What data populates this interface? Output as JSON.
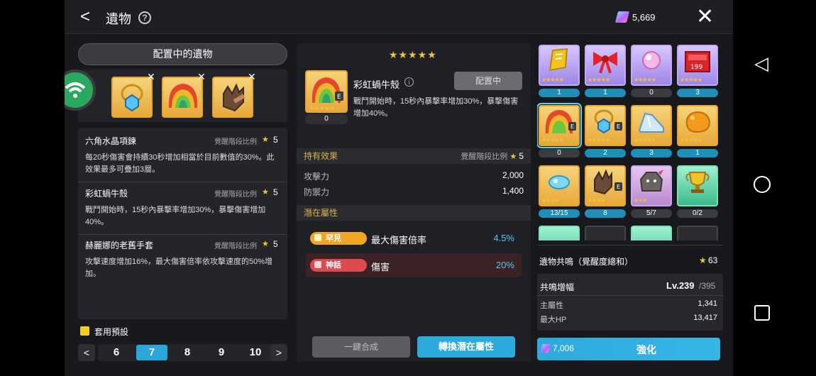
{
  "header": {
    "title": "遺物",
    "help": "?",
    "currency_value": "5,669",
    "back": "<",
    "close": "✕"
  },
  "left": {
    "equipped_header": "配置中的遺物",
    "descriptions": [
      {
        "name": "六角水晶項鍊",
        "rate_label": "覺醒階段比例",
        "star": "★",
        "level": "5",
        "desc": "每20秒傷害會持續30秒增加相當於目前數值的30%。此效果最多可疊加3層。"
      },
      {
        "name": "彩虹蝸牛殼",
        "rate_label": "覺醒階段比例",
        "star": "★",
        "level": "5",
        "desc": "戰鬥開始時，15秒內暴擊率增加30%，暴擊傷害增加40%。"
      },
      {
        "name": "赫麗娜的老舊手套",
        "rate_label": "覺醒階段比例",
        "star": "★",
        "level": "5",
        "desc": "攻擊速度增加16%，最大傷害倍率依攻擊速度的50%增加。"
      }
    ],
    "preset_label": "套用預設",
    "pages": [
      "6",
      "7",
      "8",
      "9",
      "10"
    ],
    "selected_page": "7",
    "prev": "<",
    "next": ">"
  },
  "middle": {
    "stars": "★★★★★",
    "relic_name": "彩虹蝸牛殼",
    "relic_count": "0",
    "equipped_label": "配置中",
    "description": "戰鬥開始時，15秒內暴擊率增加30%，暴擊傷害增加40%。",
    "info": "i",
    "owned_effect_header": "持有效果",
    "rate_label": "覺醒階段比例",
    "rate_star": "★",
    "rate_value": "5",
    "stats": [
      {
        "label": "攻擊力",
        "value": "2,000"
      },
      {
        "label": "防禦力",
        "value": "1,400"
      }
    ],
    "potential_header": "潛在屬性",
    "potentials": [
      {
        "grade": "罕見",
        "name": "最大傷害倍率",
        "value": "4.5%",
        "grade_color": "#f0a623",
        "value_color": "#5cc8ef"
      },
      {
        "grade": "神話",
        "name": "傷害",
        "value": "20%",
        "grade_color": "#e0484f",
        "value_color": "#5cc8ef"
      }
    ],
    "synth_button": "一鍵合成",
    "convert_button": "轉換潛在屬性"
  },
  "right": {
    "relics": [
      {
        "icon": "golden-ticket-icon",
        "count": "1",
        "stars": "★★★★★"
      },
      {
        "icon": "red-bow-icon",
        "count": "1",
        "stars": "★★★★★"
      },
      {
        "icon": "pink-orb-icon",
        "count": "0",
        "stars": "★★★★★"
      },
      {
        "icon": "red-box-icon",
        "count": "3",
        "stars": "★★★★★"
      },
      {
        "icon": "rainbow-snail-shell-icon",
        "count": "0",
        "stars": "★★★★★"
      },
      {
        "icon": "hexagon-necklace-icon",
        "count": "2",
        "stars": "★★★★★"
      },
      {
        "icon": "glass-slipper-icon",
        "count": "3",
        "stars": "★★★★★"
      },
      {
        "icon": "orange-stone-icon",
        "count": "1",
        "stars": "★★★★★"
      },
      {
        "icon": "blue-candy-icon",
        "count": "13/15",
        "stars": "★★★★"
      },
      {
        "icon": "old-glove-icon",
        "count": "8",
        "stars": "★★★★"
      },
      {
        "icon": "rock-golem-icon",
        "count": "5/7",
        "stars": "★★★"
      },
      {
        "icon": "gold-trophy-icon",
        "count": "0/2",
        "stars": ""
      }
    ],
    "resonance_label": "遺物共鳴（覺醒度總和）",
    "resonance_star": "★",
    "resonance_value": "63",
    "boost_label": "共鳴增幅",
    "level": "Lv.239",
    "level_max": "/395",
    "main_stat_label": "主屬性",
    "main_stat_value": "1,341",
    "hp_label": "最大HP",
    "hp_value": "13,417",
    "enhance_cost": "7,006",
    "enhance_label": "強化"
  },
  "android_nav": {
    "back": "◁",
    "home": "○",
    "recents": "□"
  }
}
